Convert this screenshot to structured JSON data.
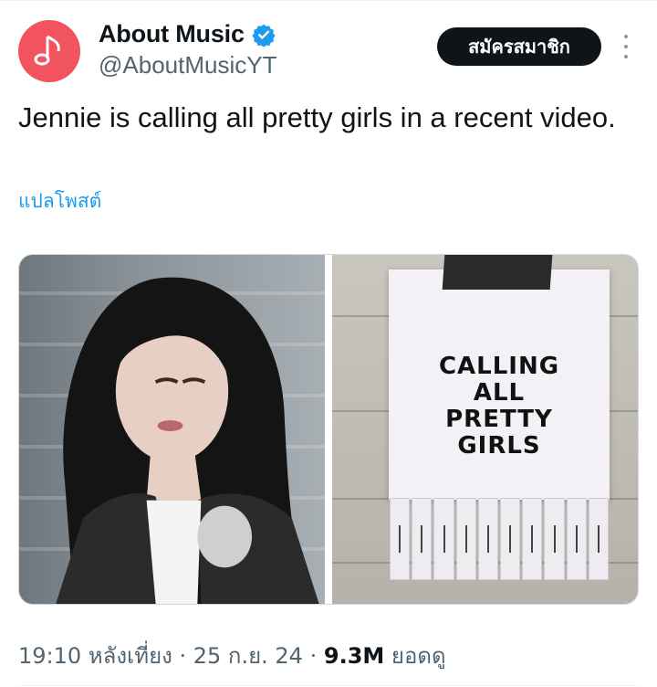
{
  "author": {
    "display_name": "About Music",
    "handle": "@AboutMusicYT",
    "avatar_icon": "music-note-icon",
    "avatar_color": "#f2545f",
    "verified_color": "#1d9bf0"
  },
  "actions": {
    "subscribe_label": "สมัครสมาชิก",
    "more_icon": "more-vertical-icon"
  },
  "tweet": {
    "text": "Jennie is calling all pretty girls in a recent video.",
    "translate_label": "แปลโพสต์"
  },
  "media": {
    "poster_lines": [
      "CALLING",
      "ALL",
      "PRETTY",
      "GIRLS"
    ]
  },
  "meta": {
    "time": "19:10 หลังเที่ยง",
    "separator": "·",
    "date": "25 ก.ย. 24",
    "views_count": "9.3M",
    "views_label": "ยอดดู"
  },
  "colors": {
    "accent": "#1d9bf0",
    "text_primary": "#0f1419",
    "text_secondary": "#536471"
  }
}
